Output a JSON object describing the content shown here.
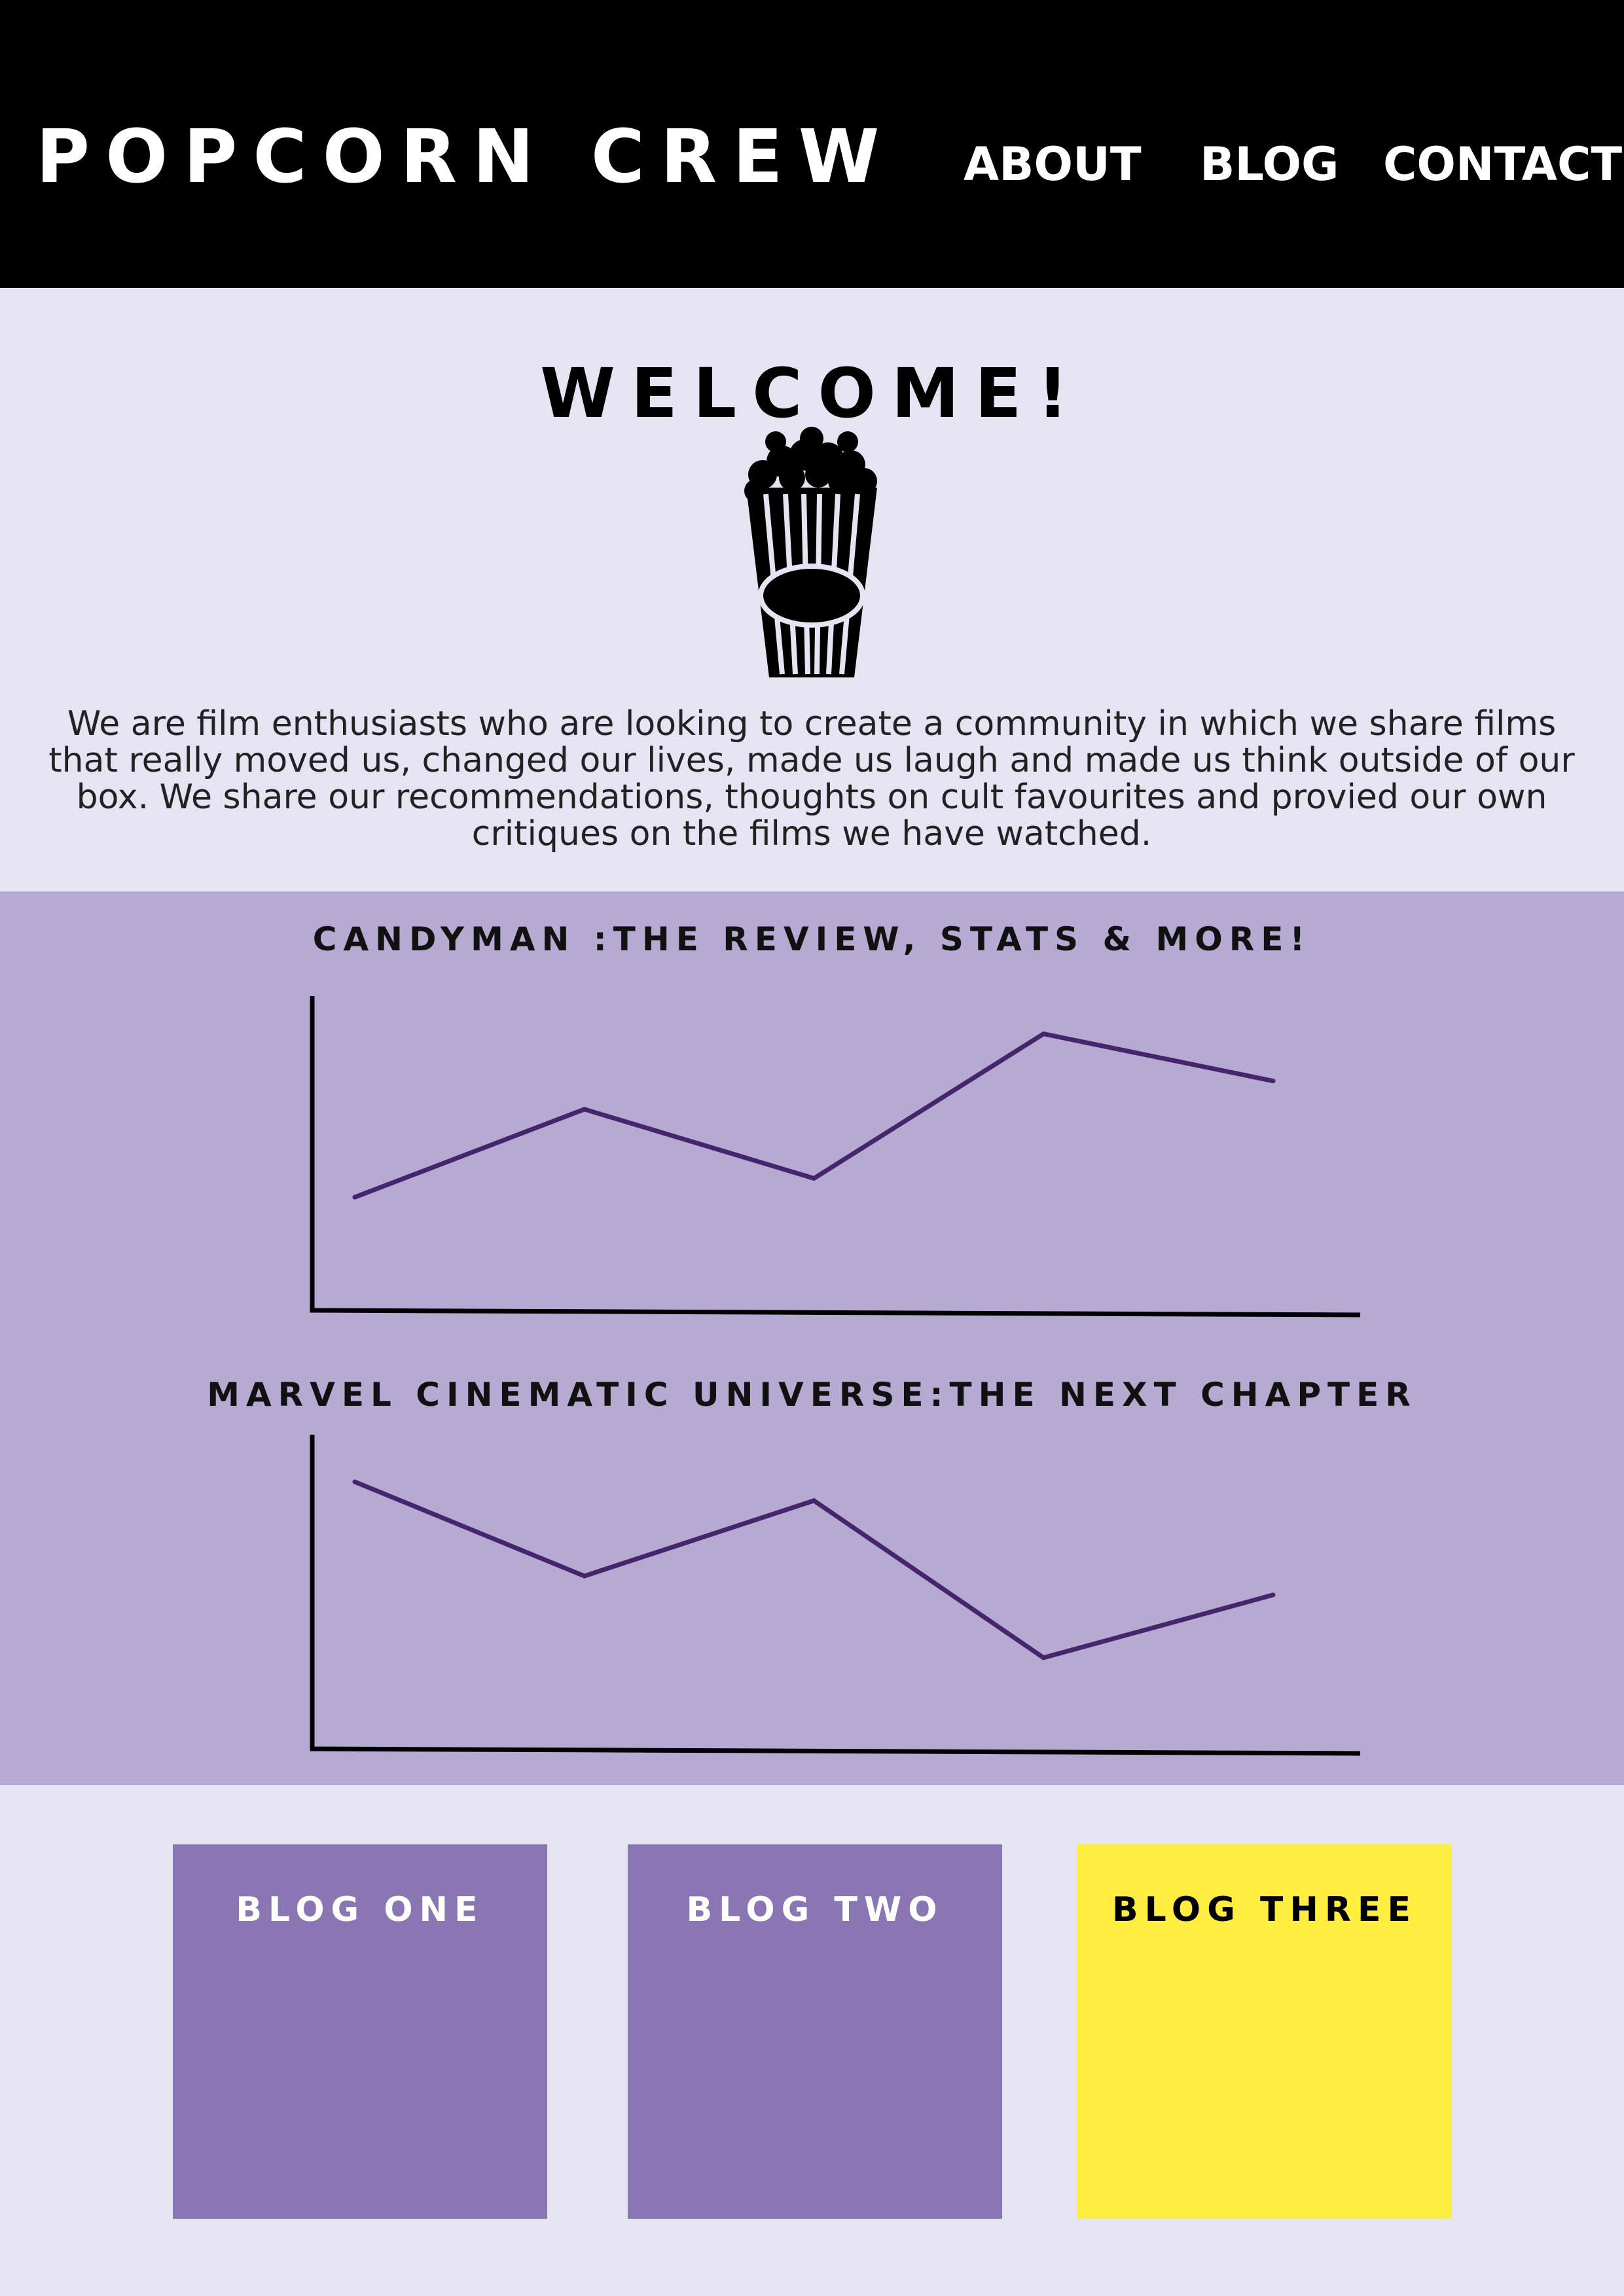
{
  "header": {
    "logo": "POPCORN CREW",
    "nav": [
      {
        "label": "ABOUT"
      },
      {
        "label": "BLOG"
      },
      {
        "label": "CONTACT"
      }
    ]
  },
  "hero": {
    "title": "WELCOME!",
    "image_icon": "popcorn-bucket-icon",
    "intro": "We are film enthusiasts who are looking to create a community in which we share films that really moved us, changed our lives, made us laugh and made us think outside of our box. We share our recommendations, thoughts on cult favourites and provied our own critiques on the films we have watched."
  },
  "stats": {
    "background": "#b6aad3",
    "line_color": "#45256b"
  },
  "chart_data": [
    {
      "type": "line",
      "title": "CANDYMAN :THE REVIEW, STATS &  MORE!",
      "xlabel": "",
      "ylabel": "",
      "x": [
        1,
        2,
        3,
        4,
        5
      ],
      "values": [
        3.6,
        6.4,
        4.2,
        8.8,
        7.3
      ],
      "ylim": [
        0,
        10
      ],
      "grid": false
    },
    {
      "type": "line",
      "title": "MARVEL CINEMATIC UNIVERSE:THE NEXT CHAPTER",
      "xlabel": "",
      "ylabel": "",
      "x": [
        1,
        2,
        3,
        4,
        5
      ],
      "values": [
        8.5,
        5.5,
        7.9,
        2.9,
        4.9
      ],
      "ylim": [
        0,
        10
      ],
      "grid": false
    }
  ],
  "blogs": [
    {
      "label": "BLOG ONE",
      "color": "#8a76b3",
      "text_color": "#ffffff"
    },
    {
      "label": "BLOG TWO",
      "color": "#8a76b3",
      "text_color": "#ffffff"
    },
    {
      "label": "BLOG THREE",
      "color": "#ffee40",
      "text_color": "#000000"
    }
  ]
}
